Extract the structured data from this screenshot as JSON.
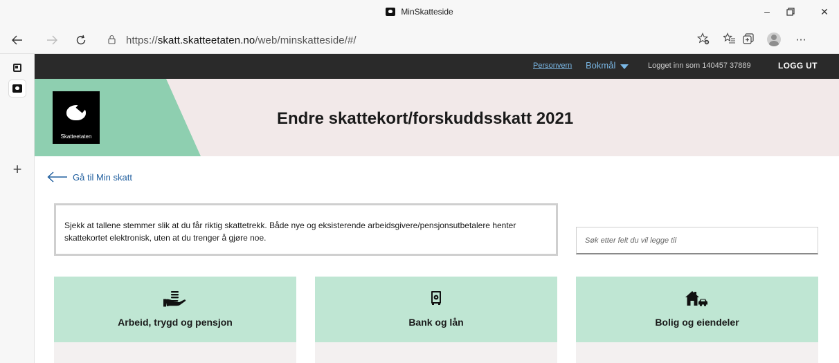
{
  "browser": {
    "window_title": "MinSkatteside",
    "url_prefix": "https://",
    "url_host": "skatt.skatteetaten.no",
    "url_path": "/web/minskatteside/#/"
  },
  "topbar": {
    "privacy": "Personvern",
    "language": "Bokmål",
    "logged_in_as": "Logget inn som 140457 37889",
    "logout": "LOGG UT"
  },
  "banner": {
    "logo_text": "Skatteetaten",
    "title": "Endre skattekort/forskuddsskatt 2021"
  },
  "back_link": {
    "label": "Gå til Min skatt"
  },
  "info": {
    "text": "Sjekk at tallene stemmer slik at du får riktig skattetrekk. Både nye og eksisterende arbeidsgivere/pensjonsutbetalere henter skattekortet elektronisk, uten at du trenger å gjøre noe."
  },
  "search": {
    "placeholder": "Søk etter felt du vil legge til"
  },
  "cards": [
    {
      "label": "Arbeid, trygd og pensjon",
      "icon": "hand-with-coins-icon"
    },
    {
      "label": "Bank og lån",
      "icon": "safe-icon"
    },
    {
      "label": "Bolig og eiendeler",
      "icon": "house-and-car-icon"
    }
  ],
  "colors": {
    "banner_bg": "#f2e9e9",
    "banner_green": "#8ecfb0",
    "card_head": "#bfe6d3",
    "topbar_bg": "#2a2a2a",
    "link": "#1f5e9e"
  }
}
